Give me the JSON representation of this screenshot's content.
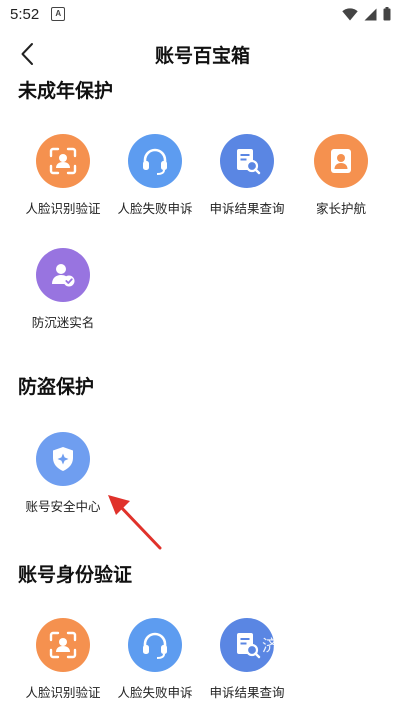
{
  "status_bar": {
    "time": "5:52",
    "notification_glyph": "A"
  },
  "header": {
    "title": "账号百宝箱"
  },
  "sections": [
    {
      "title": "未成年保护",
      "items": [
        {
          "label": "人脸识别验证",
          "icon": "face-scan-icon",
          "color": "#f5914f"
        },
        {
          "label": "人脸失败申诉",
          "icon": "headset-icon",
          "color": "#5d9cf0"
        },
        {
          "label": "申诉结果查询",
          "icon": "document-search-icon",
          "color": "#5a86e3"
        },
        {
          "label": "家长护航",
          "icon": "person-icon",
          "color": "#f5914f"
        },
        {
          "label": "防沉迷实名",
          "icon": "user-verified-icon",
          "color": "#9874e0"
        }
      ]
    },
    {
      "title": "防盗保护",
      "items": [
        {
          "label": "账号安全中心",
          "icon": "shield-icon",
          "color": "#6f9ef0"
        }
      ]
    },
    {
      "title": "账号身份验证",
      "items": [
        {
          "label": "人脸识别验证",
          "icon": "face-scan-icon",
          "color": "#f5914f"
        },
        {
          "label": "人脸失败申诉",
          "icon": "headset-icon",
          "color": "#5d9cf0"
        },
        {
          "label": "申诉结果查询",
          "icon": "document-search-icon",
          "color": "#5a86e3"
        }
      ]
    }
  ],
  "watermark": "济"
}
